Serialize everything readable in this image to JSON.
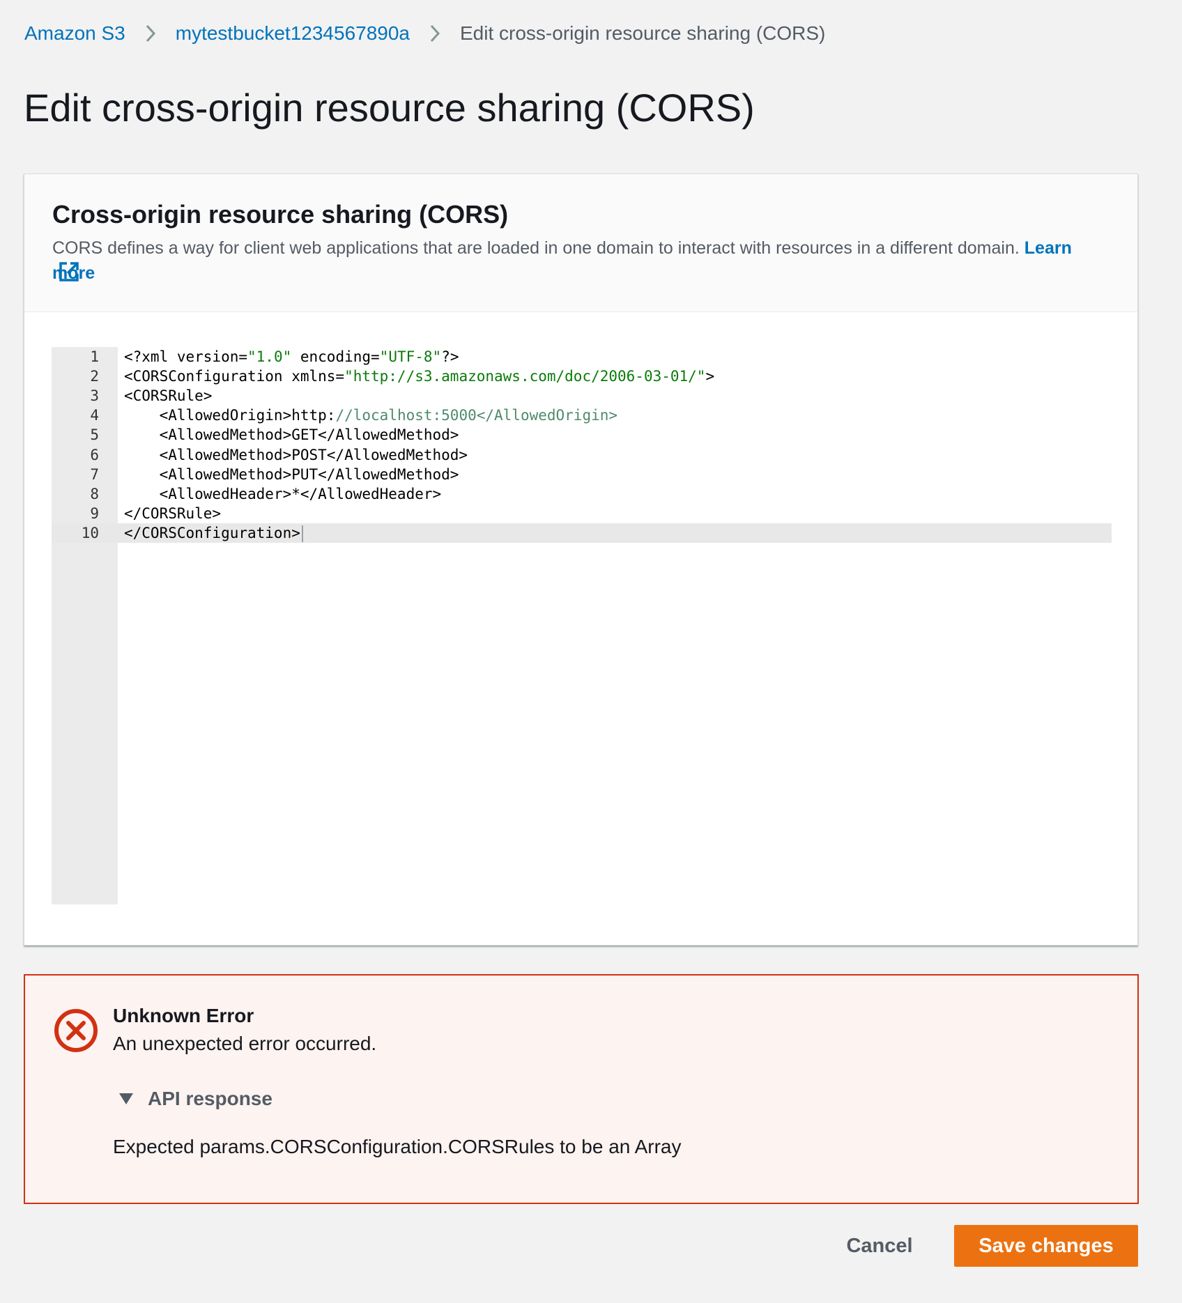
{
  "breadcrumb": {
    "items": [
      {
        "label": "Amazon S3",
        "link": true
      },
      {
        "label": "mytestbucket1234567890a",
        "link": true
      },
      {
        "label": "Edit cross-origin resource sharing (CORS)",
        "link": false
      }
    ]
  },
  "page": {
    "title": "Edit cross-origin resource sharing (CORS)"
  },
  "panel": {
    "title": "Cross-origin resource sharing (CORS)",
    "description": "CORS defines a way for client web applications that are loaded in one domain to interact with resources in a different domain.",
    "learn_more": "Learn more",
    "icons": {
      "external_link": "external-link-icon"
    }
  },
  "editor": {
    "active_line": 10,
    "lines": [
      {
        "no": "1",
        "segments": [
          {
            "t": "<?xml version=",
            "c": "plain"
          },
          {
            "t": "\"1.0\"",
            "c": "str"
          },
          {
            "t": " encoding=",
            "c": "plain"
          },
          {
            "t": "\"UTF-8\"",
            "c": "str"
          },
          {
            "t": "?>",
            "c": "plain"
          }
        ]
      },
      {
        "no": "2",
        "segments": [
          {
            "t": "<CORSConfiguration xmlns=",
            "c": "plain"
          },
          {
            "t": "\"http://s3.amazonaws.com/doc/2006-03-01/\"",
            "c": "str"
          },
          {
            "t": ">",
            "c": "plain"
          }
        ]
      },
      {
        "no": "3",
        "segments": [
          {
            "t": "<CORSRule>",
            "c": "plain"
          }
        ]
      },
      {
        "no": "4",
        "segments": [
          {
            "t": "    <AllowedOrigin>http:",
            "c": "plain"
          },
          {
            "t": "//localhost:5000</AllowedOrigin>",
            "c": "faded"
          }
        ]
      },
      {
        "no": "5",
        "segments": [
          {
            "t": "    <AllowedMethod>GET</AllowedMethod>",
            "c": "plain"
          }
        ]
      },
      {
        "no": "6",
        "segments": [
          {
            "t": "    <AllowedMethod>POST</AllowedMethod>",
            "c": "plain"
          }
        ]
      },
      {
        "no": "7",
        "segments": [
          {
            "t": "    <AllowedMethod>PUT</AllowedMethod>",
            "c": "plain"
          }
        ]
      },
      {
        "no": "8",
        "segments": [
          {
            "t": "    <AllowedHeader>*</AllowedHeader>",
            "c": "plain"
          }
        ]
      },
      {
        "no": "9",
        "segments": [
          {
            "t": "</CORSRule>",
            "c": "plain"
          }
        ]
      },
      {
        "no": "10",
        "segments": [
          {
            "t": "</CORSConfiguration>",
            "c": "plain"
          }
        ]
      }
    ]
  },
  "alert": {
    "title": "Unknown Error",
    "message": "An unexpected error occurred.",
    "expander_label": "API response",
    "expanded": true,
    "api_response": "Expected params.CORSConfiguration.CORSRules to be an Array",
    "icons": {
      "status": "error-x-icon",
      "expander": "caret-down-icon"
    }
  },
  "footer": {
    "cancel_label": "Cancel",
    "save_label": "Save changes"
  },
  "colors": {
    "link": "#0073bb",
    "primary_button": "#ec7211",
    "error": "#d13212",
    "error_bg": "#fdf3f1",
    "page_bg": "#f2f2f2",
    "code_string": "#0b7a0b"
  }
}
